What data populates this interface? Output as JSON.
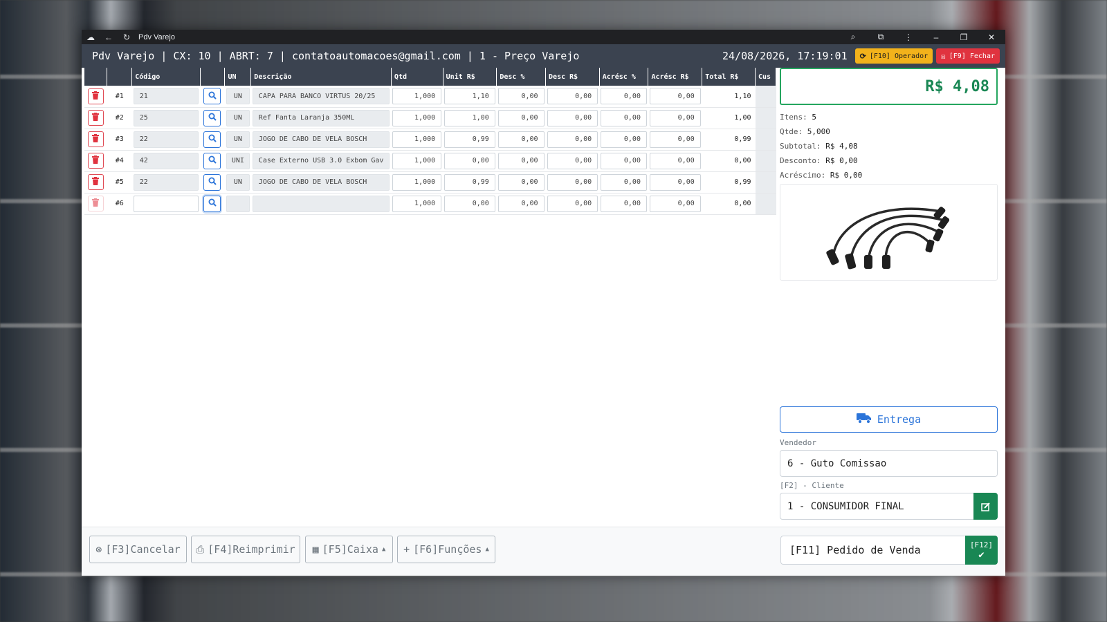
{
  "titlebar": {
    "title": "Pdv Varejo"
  },
  "header": {
    "info": "Pdv Varejo | CX: 10 | ABRT: 7 | contatoautomacoes@gmail.com | 1 - Preço Varejo",
    "datetime": "24/08/2026, 17:19:01",
    "operator_btn": "[F10] Operador",
    "close_btn": "[F9] Fechar"
  },
  "grid": {
    "columns": [
      "",
      "",
      "Código",
      "",
      "UN",
      "Descrição",
      "Qtd",
      "Unit R$",
      "Desc %",
      "Desc R$",
      "Acrésc %",
      "Acrésc R$",
      "Total R$",
      "Cus"
    ],
    "rows": [
      {
        "num": "#1",
        "code": "21",
        "un": "UN",
        "desc": "CAPA PARA BANCO VIRTUS 20/25",
        "qtd": "1,000",
        "unit": "1,10",
        "desc_pct": "0,00",
        "desc_val": "0,00",
        "acr_pct": "0,00",
        "acr_val": "0,00",
        "total": "1,10"
      },
      {
        "num": "#2",
        "code": "25",
        "un": "UN",
        "desc": "Ref Fanta Laranja 350ML",
        "qtd": "1,000",
        "unit": "1,00",
        "desc_pct": "0,00",
        "desc_val": "0,00",
        "acr_pct": "0,00",
        "acr_val": "0,00",
        "total": "1,00"
      },
      {
        "num": "#3",
        "code": "22",
        "un": "UN",
        "desc": "JOGO DE CABO DE VELA BOSCH",
        "qtd": "1,000",
        "unit": "0,99",
        "desc_pct": "0,00",
        "desc_val": "0,00",
        "acr_pct": "0,00",
        "acr_val": "0,00",
        "total": "0,99"
      },
      {
        "num": "#4",
        "code": "42",
        "un": "UNI",
        "desc": "Case Externo USB 3.0 Exbom Gav",
        "qtd": "1,000",
        "unit": "0,00",
        "desc_pct": "0,00",
        "desc_val": "0,00",
        "acr_pct": "0,00",
        "acr_val": "0,00",
        "total": "0,00"
      },
      {
        "num": "#5",
        "code": "22",
        "un": "UN",
        "desc": "JOGO DE CABO DE VELA BOSCH",
        "qtd": "1,000",
        "unit": "0,99",
        "desc_pct": "0,00",
        "desc_val": "0,00",
        "acr_pct": "0,00",
        "acr_val": "0,00",
        "total": "0,99"
      },
      {
        "num": "#6",
        "code": "",
        "un": "",
        "desc": "",
        "qtd": "1,000",
        "unit": "0,00",
        "desc_pct": "0,00",
        "desc_val": "0,00",
        "acr_pct": "0,00",
        "acr_val": "0,00",
        "total": "0,00"
      }
    ]
  },
  "summary": {
    "total": "R$ 4,08",
    "itens_label": "Itens:",
    "itens": "5",
    "qtde_label": "Qtde:",
    "qtde": "5,000",
    "subtotal_label": "Subtotal:",
    "subtotal": "R$ 4,08",
    "desconto_label": "Desconto:",
    "desconto": "R$ 0,00",
    "acrescimo_label": "Acréscimo:",
    "acrescimo": "R$ 0,00"
  },
  "delivery": {
    "label": "Entrega"
  },
  "seller": {
    "label": "Vendedor",
    "value": "6 - Guto Comissao"
  },
  "client": {
    "label": "[F2] - Cliente",
    "value": "1 - CONSUMIDOR FINAL"
  },
  "footer": {
    "cancel": "[F3]Cancelar",
    "reprint": "[F4]Reimprimir",
    "cashier": "[F5]Caixa",
    "functions": "[F6]Funções",
    "order_type": "[F11] Pedido de Venda",
    "confirm_key": "[F12]"
  },
  "colors": {
    "header": "#3b4350",
    "success": "#198754",
    "primary": "#2b74d9",
    "danger": "#e0333f",
    "warning": "#f2b21b"
  }
}
